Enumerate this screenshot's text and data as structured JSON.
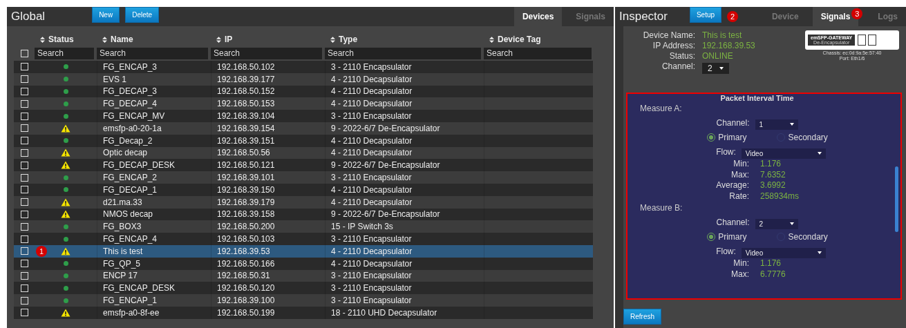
{
  "global": {
    "title": "Global",
    "buttons": [
      "New",
      "Delete"
    ],
    "tabs": [
      {
        "label": "Devices",
        "selected": true
      },
      {
        "label": "Signals",
        "selected": false
      }
    ]
  },
  "table": {
    "select_all_checked": false,
    "columns": [
      "Status",
      "Name",
      "IP",
      "Type",
      "Device Tag"
    ],
    "search_placeholders": [
      "Search",
      "Search",
      "Search",
      "Search",
      "Search"
    ],
    "rows": [
      {
        "kind": "ok",
        "name": "FG_ENCAP_3",
        "ip": "192.168.50.102",
        "type": "3 - 2110 Encapsulator",
        "checked": false,
        "selected": false
      },
      {
        "kind": "ok",
        "name": "EVS 1",
        "ip": "192.168.39.177",
        "type": "4 - 2110 Decapsulator",
        "checked": false,
        "selected": false
      },
      {
        "kind": "ok",
        "name": "FG_DECAP_3",
        "ip": "192.168.50.152",
        "type": "4 - 2110 Decapsulator",
        "checked": false,
        "selected": false
      },
      {
        "kind": "ok",
        "name": "FG_DECAP_4",
        "ip": "192.168.50.153",
        "type": "4 - 2110 Decapsulator",
        "checked": false,
        "selected": false
      },
      {
        "kind": "ok",
        "name": "FG_ENCAP_MV",
        "ip": "192.168.39.104",
        "type": "3 - 2110 Encapsulator",
        "checked": false,
        "selected": false
      },
      {
        "kind": "warning",
        "name": "emsfp-a0-20-1a",
        "ip": "192.168.39.154",
        "type": "9 - 2022-6/7 De-Encapsulator",
        "checked": false,
        "selected": false
      },
      {
        "kind": "ok",
        "name": "FG_Decap_2",
        "ip": "192.168.39.151",
        "type": "4 - 2110 Decapsulator",
        "checked": false,
        "selected": false
      },
      {
        "kind": "warning",
        "name": "Optic decap",
        "ip": "192.168.50.56",
        "type": "4 - 2110 Decapsulator",
        "checked": false,
        "selected": false
      },
      {
        "kind": "warning",
        "name": "FG_DECAP_DESK",
        "ip": "192.168.50.121",
        "type": "9 - 2022-6/7 De-Encapsulator",
        "checked": false,
        "selected": false
      },
      {
        "kind": "ok",
        "name": "FG_ENCAP_2",
        "ip": "192.168.39.101",
        "type": "3 - 2110 Encapsulator",
        "checked": false,
        "selected": false
      },
      {
        "kind": "ok",
        "name": "FG_DECAP_1",
        "ip": "192.168.39.150",
        "type": "4 - 2110 Decapsulator",
        "checked": false,
        "selected": false
      },
      {
        "kind": "warning",
        "name": "d21.ma.33",
        "ip": "192.168.39.179",
        "type": "4 - 2110 Decapsulator",
        "checked": false,
        "selected": false
      },
      {
        "kind": "warning",
        "name": "NMOS decap",
        "ip": "192.168.39.158",
        "type": "9 - 2022-6/7 De-Encapsulator",
        "checked": false,
        "selected": false
      },
      {
        "kind": "ok",
        "name": "FG_BOX3",
        "ip": "192.168.50.200",
        "type": "15 - IP Switch 3s",
        "checked": false,
        "selected": false
      },
      {
        "kind": "ok",
        "name": "FG_ENCAP_4",
        "ip": "192.168.50.103",
        "type": "3 - 2110 Encapsulator",
        "checked": false,
        "selected": false
      },
      {
        "kind": "warning",
        "name": "This is test",
        "ip": "192.168.39.53",
        "type": "4 - 2110 Decapsulator",
        "checked": false,
        "selected": true,
        "badge": "1"
      },
      {
        "kind": "ok",
        "name": "FG_QP_5",
        "ip": "192.168.50.166",
        "type": "4 - 2110 Decapsulator",
        "checked": false,
        "selected": false
      },
      {
        "kind": "ok",
        "name": "ENCP 17",
        "ip": "192.168.50.31",
        "type": "3 - 2110 Encapsulator",
        "checked": false,
        "selected": false
      },
      {
        "kind": "ok",
        "name": "FG_ENCAP_DESK",
        "ip": "192.168.50.120",
        "type": "3 - 2110 Encapsulator",
        "checked": false,
        "selected": false
      },
      {
        "kind": "ok",
        "name": "FG_ENCAP_1",
        "ip": "192.168.39.100",
        "type": "3 - 2110 Encapsulator",
        "checked": false,
        "selected": false
      },
      {
        "kind": "warning",
        "name": "emsfp-a0-8f-ee",
        "ip": "192.168.50.199",
        "type": "18 - 2110 UHD Decapsulator",
        "checked": false,
        "selected": false
      }
    ]
  },
  "inspector": {
    "title": "Inspector",
    "setup_button": "Setup",
    "setup_badge": "2",
    "tabs": [
      {
        "label": "Device",
        "selected": false
      },
      {
        "label": "Signals",
        "selected": true,
        "badge": "3"
      },
      {
        "label": "Logs",
        "selected": false
      }
    ],
    "info": [
      {
        "label": "Device Name:",
        "value": "This is test"
      },
      {
        "label": "IP Address:",
        "value": "192.168.39.53"
      },
      {
        "label": "Status:",
        "value": "ONLINE"
      }
    ],
    "channel_label": "Channel:",
    "channel": "2",
    "device_image": {
      "name": "emSFP-GATEWAY",
      "subtitle": "De-Encapsulator",
      "chassis": "Chassis: ec:0d:9a:5e:57:40",
      "port": "Port: Eth1/6"
    },
    "signal_panel": {
      "title": "Packet Interval Time",
      "highlighted": true,
      "measures": [
        {
          "label": "Measure A:",
          "channel_label": "Channel:",
          "channel": "1",
          "options": [
            {
              "label": "Primary",
              "selected": true
            },
            {
              "label": "Secondary",
              "selected": false
            }
          ],
          "flow_label": "Flow:",
          "flow": "Video",
          "stats": [
            {
              "label": "Min:",
              "value": "1.176"
            },
            {
              "label": "Max:",
              "value": "7.6352"
            },
            {
              "label": "Average:",
              "value": "3.6992"
            },
            {
              "label": "Rate:",
              "value": "258934ms"
            }
          ]
        },
        {
          "label": "Measure B:",
          "channel_label": "Channel:",
          "channel": "2",
          "options": [
            {
              "label": "Primary",
              "selected": true
            },
            {
              "label": "Secondary",
              "selected": false
            }
          ],
          "flow_label": "Flow:",
          "flow": "Video",
          "stats": [
            {
              "label": "Min:",
              "value": "1.176"
            },
            {
              "label": "Max:",
              "value": "6.7776"
            }
          ]
        }
      ]
    },
    "refresh_button": "Refresh"
  }
}
